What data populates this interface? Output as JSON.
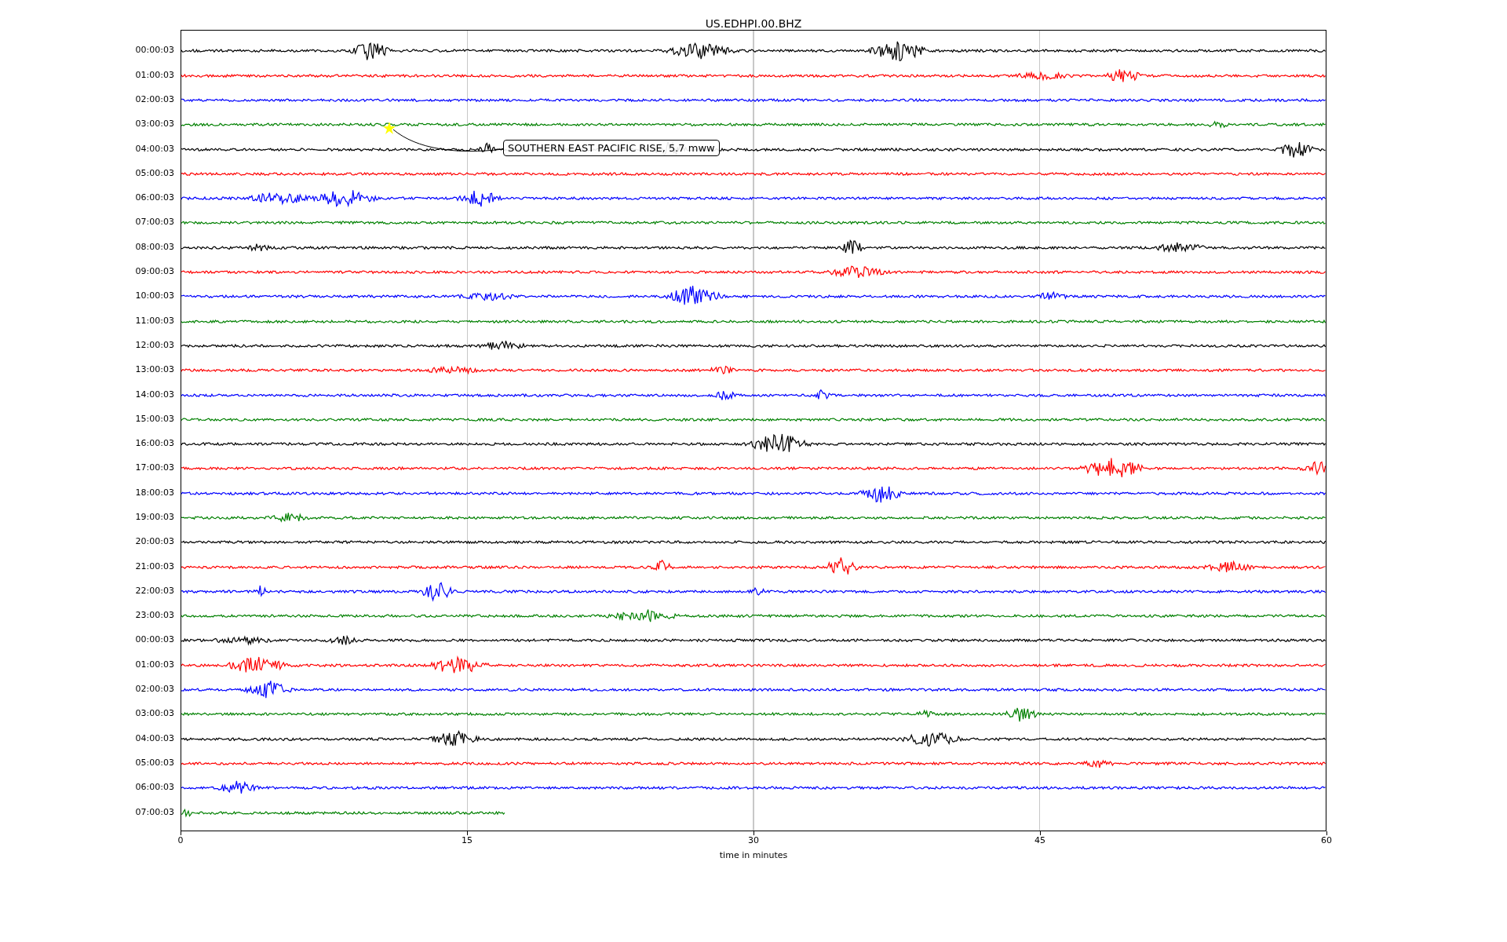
{
  "title": "US.EDHPI.00.BHZ",
  "rows": [
    {
      "label": "00:00:03",
      "color": "#000000",
      "level": 1
    },
    {
      "label": "01:00:03",
      "color": "#ff0000",
      "level": 1
    },
    {
      "label": "02:00:03",
      "color": "#0000ff",
      "level": 1
    },
    {
      "label": "03:00:03",
      "color": "#008000",
      "level": 1
    },
    {
      "label": "04:00:03",
      "color": "#000000",
      "level": 1
    },
    {
      "label": "05:00:03",
      "color": "#ff0000",
      "level": 1
    },
    {
      "label": "06:00:03",
      "color": "#0000ff",
      "level": 1
    },
    {
      "label": "07:00:03",
      "color": "#008000",
      "level": 1
    },
    {
      "label": "08:00:03",
      "color": "#000000",
      "level": 1
    },
    {
      "label": "09:00:03",
      "color": "#ff0000",
      "level": 1
    },
    {
      "label": "10:00:03",
      "color": "#0000ff",
      "level": 1
    },
    {
      "label": "11:00:03",
      "color": "#008000",
      "level": 1
    },
    {
      "label": "12:00:03",
      "color": "#000000",
      "level": 1
    },
    {
      "label": "13:00:03",
      "color": "#ff0000",
      "level": 1
    },
    {
      "label": "14:00:03",
      "color": "#0000ff",
      "level": 1
    },
    {
      "label": "15:00:03",
      "color": "#008000",
      "level": 1
    },
    {
      "label": "16:00:03",
      "color": "#000000",
      "level": 1
    },
    {
      "label": "17:00:03",
      "color": "#ff0000",
      "level": 1
    },
    {
      "label": "18:00:03",
      "color": "#0000ff",
      "level": 1
    },
    {
      "label": "19:00:03",
      "color": "#008000",
      "level": 1
    },
    {
      "label": "20:00:03",
      "color": "#000000",
      "level": 1
    },
    {
      "label": "21:00:03",
      "color": "#ff0000",
      "level": 1
    },
    {
      "label": "22:00:03",
      "color": "#0000ff",
      "level": 1
    },
    {
      "label": "23:00:03",
      "color": "#008000",
      "level": 1
    },
    {
      "label": "00:00:03",
      "color": "#000000",
      "level": 1
    },
    {
      "label": "01:00:03",
      "color": "#ff0000",
      "level": 1
    },
    {
      "label": "02:00:03",
      "color": "#0000ff",
      "level": 1
    },
    {
      "label": "03:00:03",
      "color": "#008000",
      "level": 1
    },
    {
      "label": "04:00:03",
      "color": "#000000",
      "level": 1
    },
    {
      "label": "05:00:03",
      "color": "#ff0000",
      "level": 1
    },
    {
      "label": "06:00:03",
      "color": "#0000ff",
      "level": 1
    },
    {
      "label": "07:00:03",
      "color": "#008000",
      "level": 0.283
    }
  ],
  "xticks": [
    "0",
    "15",
    "30",
    "45",
    "60"
  ],
  "xlabel": "time in minutes",
  "annotation": {
    "label": "SOUTHERN EAST PACIFIC RISE, 5.7 mww"
  }
}
